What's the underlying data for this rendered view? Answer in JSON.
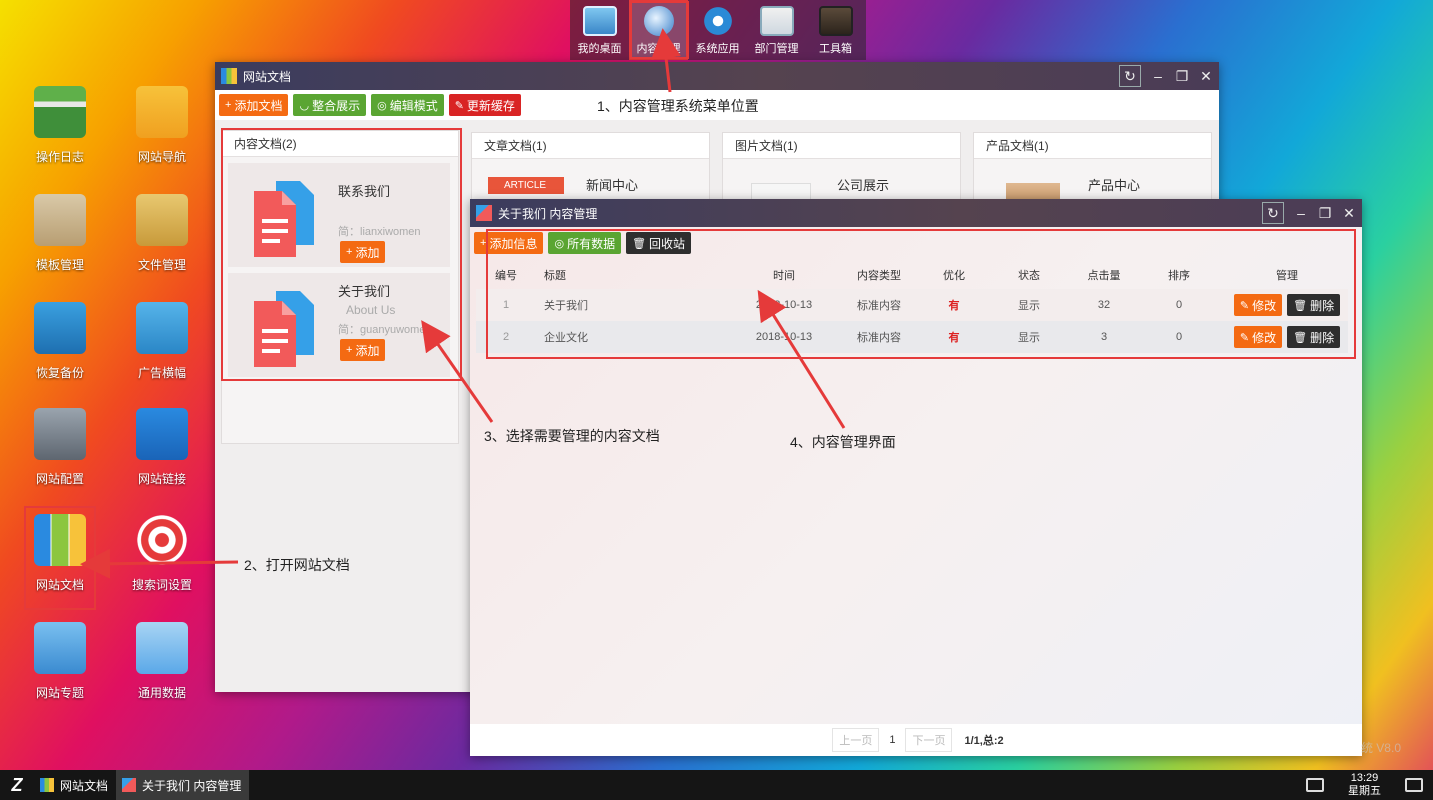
{
  "dock": {
    "items": [
      {
        "label": "我的桌面",
        "icon": "monitor-icon"
      },
      {
        "label": "内容管理",
        "icon": "globe-icon",
        "active": true
      },
      {
        "label": "系统应用",
        "icon": "gear-icon"
      },
      {
        "label": "部门管理",
        "icon": "id-card-icon"
      },
      {
        "label": "工具箱",
        "icon": "toolbox-icon"
      }
    ]
  },
  "desktop": {
    "icons": [
      {
        "label": "操作日志",
        "icon": "folder-log-icon"
      },
      {
        "label": "网站导航",
        "icon": "nav-folder-icon"
      },
      {
        "label": "模板管理",
        "icon": "template-box-icon"
      },
      {
        "label": "文件管理",
        "icon": "file-folder-icon"
      },
      {
        "label": "恢复备份",
        "icon": "server-backup-icon"
      },
      {
        "label": "广告横幅",
        "icon": "banner-icon"
      },
      {
        "label": "网站配置",
        "icon": "server-config-icon"
      },
      {
        "label": "网站链接",
        "icon": "link-doc-icon"
      },
      {
        "label": "网站文档",
        "icon": "binders-icon",
        "selected": true
      },
      {
        "label": "搜索词设置",
        "icon": "target-icon"
      },
      {
        "label": "网站专题",
        "icon": "topic-book-icon"
      },
      {
        "label": "通用数据",
        "icon": "data-doc-icon"
      }
    ]
  },
  "docs_window": {
    "title": "网站文档",
    "toolbar": {
      "add": "添加文档",
      "integrate": "整合展示",
      "edit_mode": "编辑模式",
      "refresh_cache": "更新缓存"
    },
    "panels": [
      {
        "title": "内容文档(2)"
      },
      {
        "title": "文章文档(1)",
        "card_title": "新闻中心",
        "badge": "ARTICLE"
      },
      {
        "title": "图片文档(1)",
        "card_title": "公司展示"
      },
      {
        "title": "产品文档(1)",
        "card_title": "产品中心"
      }
    ],
    "content_cards": [
      {
        "title": "联系我们",
        "sub": "简：lianxiwomen",
        "add": "添加"
      },
      {
        "title": "关于我们",
        "en": "About Us",
        "sub": "简：guanyuwomen",
        "add": "添加"
      }
    ]
  },
  "content_window": {
    "title": "关于我们 内容管理",
    "toolbar": {
      "add": "添加信息",
      "all": "所有数据",
      "recycle": "回收站"
    },
    "columns": [
      "编号",
      "标题",
      "时间",
      "内容类型",
      "优化",
      "状态",
      "点击量",
      "排序",
      "管理"
    ],
    "rows": [
      {
        "id": "1",
        "title": "关于我们",
        "time": "2018-10-13",
        "type": "标准内容",
        "opt": "有",
        "status": "显示",
        "clicks": "32",
        "order": "0"
      },
      {
        "id": "2",
        "title": "企业文化",
        "time": "2018-10-13",
        "type": "标准内容",
        "opt": "有",
        "status": "显示",
        "clicks": "3",
        "order": "0"
      }
    ],
    "actions": {
      "edit": "修改",
      "delete": "删除"
    },
    "pager": {
      "prev": "上一页",
      "current": "1",
      "next": "下一页",
      "summary": "1/1,总:2"
    }
  },
  "annotations": {
    "step1": "1、内容管理系统菜单位置",
    "step2": "2、打开网站文档",
    "step3": "3、选择需要管理的内容文档",
    "step4": "4、内容管理界面"
  },
  "taskbar": {
    "start": "Z",
    "tasks": [
      {
        "label": "网站文档"
      },
      {
        "label": "关于我们 内容管理",
        "active": true
      }
    ],
    "time": "13:29",
    "weekday": "星期五"
  },
  "watermark": "统 V8.0",
  "colors": {
    "accent_orange": "#f46a12",
    "accent_green": "#5aa532",
    "accent_red": "#d92424",
    "annotation_red": "#e53a3a"
  }
}
